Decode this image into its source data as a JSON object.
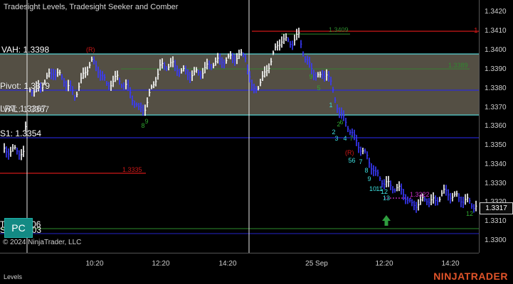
{
  "indicator_title": "Tradesight Levels, Tradesight Seeker and Comber",
  "levels": {
    "vah": "VAH: 1.3398",
    "pivot": "Pivot: 1.3379",
    "lrt": "LRT: 1.3367",
    "val": "VAL: 1.3367",
    "s1": "S1: 1.3354",
    "level_1335": "1.3335",
    "t1": "T1: 1.3306",
    "s3": "S3: 1.3303",
    "level_1340": "1.3409",
    "level_1339": "1.3389",
    "level_1332": "1.3322",
    "marker_1": "1",
    "r_left": "(R)",
    "r_right": "(R)"
  },
  "copyright": "© 2024 NinjaTrader, LLC",
  "price_axis": {
    "ticks": [
      "1.3420",
      "1.3410",
      "1.3400",
      "1.3390",
      "1.3380",
      "1.3370",
      "1.3360",
      "1.3350",
      "1.3340",
      "1.3330",
      "1.3320",
      "1.3310",
      "1.3300"
    ],
    "current_price": "1.3317"
  },
  "time_axis": {
    "ticks": [
      "10:20",
      "12:20",
      "14:20",
      "25 Sep",
      "12:20",
      "14:20"
    ]
  },
  "status_bar": {
    "tab_label": "Levels",
    "brand": "NINJATRADER"
  },
  "pc_badge": "PC",
  "seeker_labels": {
    "green": [
      "9",
      "8",
      "5",
      "6",
      "2",
      "7",
      "9",
      "12"
    ],
    "cyan": [
      "1",
      "2",
      "3",
      "4",
      "5",
      "6",
      "7",
      "8",
      "9",
      "10",
      "11",
      "12",
      "13"
    ]
  },
  "colors": {
    "value_area_fill": "#5b564a",
    "value_area_border": "#58d4d4",
    "pivot_line": "#2a2ad6",
    "resistance_red": "#d01818",
    "support_blue": "#2323c8",
    "target_green": "#2e8b2e",
    "magenta": "#d030d0",
    "bar_white": "#ffffff",
    "bar_blue": "#3a3aff",
    "cyan_text": "#3ee0e0",
    "green_text": "#2fa52f",
    "brand_orange": "#e2542a",
    "badge_teal": "#138a84",
    "arrow_green": "#2e9e3e"
  },
  "icons": {
    "arrow": "up-arrow-icon"
  }
}
